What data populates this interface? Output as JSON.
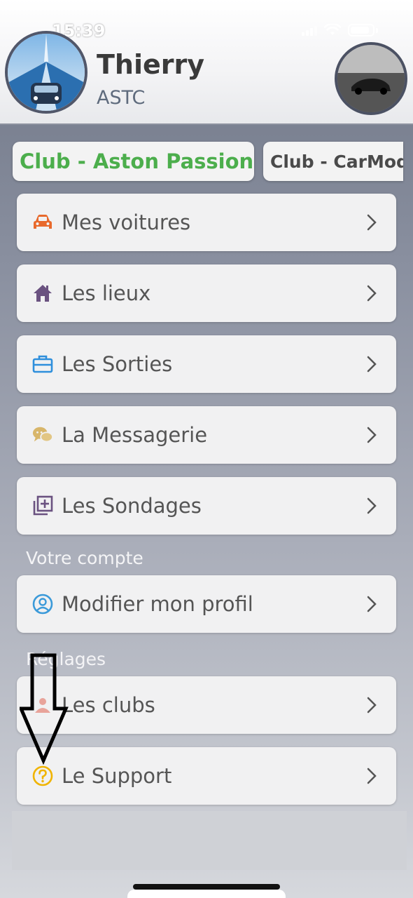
{
  "status_bar": {
    "time": "15:39"
  },
  "profile": {
    "name": "Thierry",
    "subtitle": "ASTC"
  },
  "club_tabs": [
    {
      "label": "Club - Aston Passion",
      "active": true
    },
    {
      "label": "Club - CarMod",
      "active": false
    }
  ],
  "menu": [
    {
      "label": "Mes voitures",
      "icon": "car-icon",
      "color": "#e8692c"
    },
    {
      "label": "Les lieux",
      "icon": "house-icon",
      "color": "#6a5280"
    },
    {
      "label": "Les Sorties",
      "icon": "briefcase-icon",
      "color": "#2f8fdc"
    },
    {
      "label": "La Messagerie",
      "icon": "chat-bubbles-icon",
      "color": "#d8b66a"
    },
    {
      "label": "Les Sondages",
      "icon": "add-square-icon",
      "color": "#6a5280"
    }
  ],
  "account_section": {
    "title": "Votre compte",
    "items": [
      {
        "label": "Modifier mon profil",
        "icon": "user-circle-icon",
        "color": "#3b9ad9"
      }
    ]
  },
  "settings_section": {
    "title": "Réglages",
    "items": [
      {
        "label": "Les clubs",
        "icon": "group-icon",
        "color": "#e8a39a"
      },
      {
        "label": "Le Support",
        "icon": "question-circle-icon",
        "color": "#f0b400"
      }
    ]
  }
}
